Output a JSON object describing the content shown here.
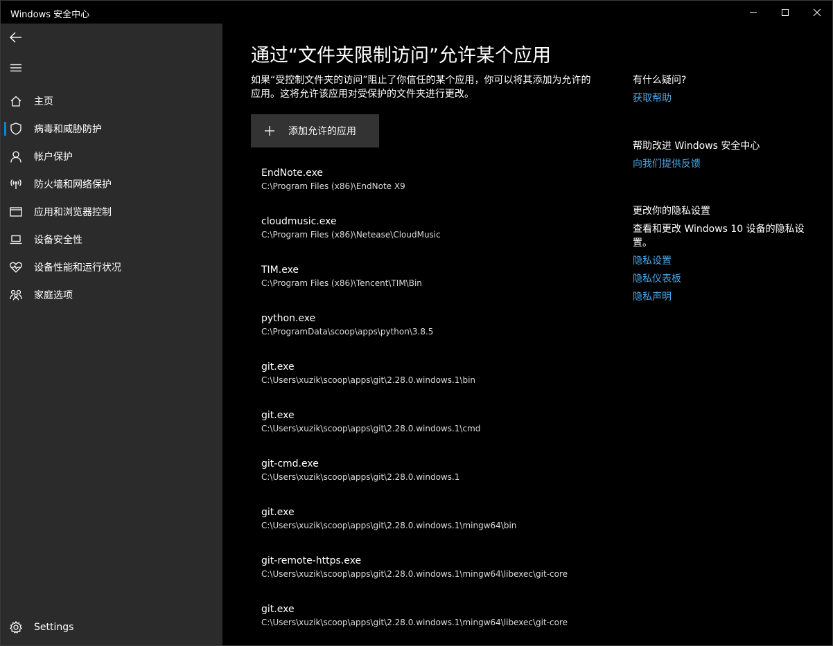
{
  "window": {
    "title": "Windows 安全中心"
  },
  "sidebar": {
    "items": [
      {
        "label": "主页",
        "icon": "home-icon"
      },
      {
        "label": "病毒和威胁防护",
        "icon": "shield-icon",
        "selected": true
      },
      {
        "label": "帐户保护",
        "icon": "person-icon"
      },
      {
        "label": "防火墙和网络保护",
        "icon": "wireless-icon"
      },
      {
        "label": "应用和浏览器控制",
        "icon": "browser-window-icon"
      },
      {
        "label": "设备安全性",
        "icon": "laptop-icon"
      },
      {
        "label": "设备性能和运行状况",
        "icon": "heart-pulse-icon"
      },
      {
        "label": "家庭选项",
        "icon": "family-icon"
      }
    ],
    "settings_label": "Settings"
  },
  "main": {
    "title": "通过“文件夹限制访问”允许某个应用",
    "description": "如果“受控制文件夹的访问”阻止了你信任的某个应用，你可以将其添加为允许的应用。这将允许该应用对受保护的文件夹进行更改。",
    "add_button_label": "添加允许的应用",
    "apps": [
      {
        "name": "EndNote.exe",
        "path": "C:\\Program Files (x86)\\EndNote X9"
      },
      {
        "name": "cloudmusic.exe",
        "path": "C:\\Program Files (x86)\\Netease\\CloudMusic"
      },
      {
        "name": "TIM.exe",
        "path": "C:\\Program Files (x86)\\Tencent\\TIM\\Bin"
      },
      {
        "name": "python.exe",
        "path": "C:\\ProgramData\\scoop\\apps\\python\\3.8.5"
      },
      {
        "name": "git.exe",
        "path": "C:\\Users\\xuzik\\scoop\\apps\\git\\2.28.0.windows.1\\bin"
      },
      {
        "name": "git.exe",
        "path": "C:\\Users\\xuzik\\scoop\\apps\\git\\2.28.0.windows.1\\cmd"
      },
      {
        "name": "git-cmd.exe",
        "path": "C:\\Users\\xuzik\\scoop\\apps\\git\\2.28.0.windows.1"
      },
      {
        "name": "git.exe",
        "path": "C:\\Users\\xuzik\\scoop\\apps\\git\\2.28.0.windows.1\\mingw64\\bin"
      },
      {
        "name": "git-remote-https.exe",
        "path": "C:\\Users\\xuzik\\scoop\\apps\\git\\2.28.0.windows.1\\mingw64\\libexec\\git-core"
      },
      {
        "name": "git.exe",
        "path": "C:\\Users\\xuzik\\scoop\\apps\\git\\2.28.0.windows.1\\mingw64\\libexec\\git-core"
      }
    ]
  },
  "aside": {
    "help": {
      "title": "有什么疑问?",
      "link": "获取帮助"
    },
    "improve": {
      "title": "帮助改进 Windows 安全中心",
      "link": "向我们提供反馈"
    },
    "privacy": {
      "title": "更改你的隐私设置",
      "body": "查看和更改 Windows 10 设备的隐私设置。",
      "links": [
        "隐私设置",
        "隐私仪表板",
        "隐私声明"
      ]
    }
  },
  "colors": {
    "accent": "#0a84d6",
    "link": "#4ba7e8",
    "sidebar_bg": "#2b2b2b",
    "main_bg": "#000000"
  }
}
